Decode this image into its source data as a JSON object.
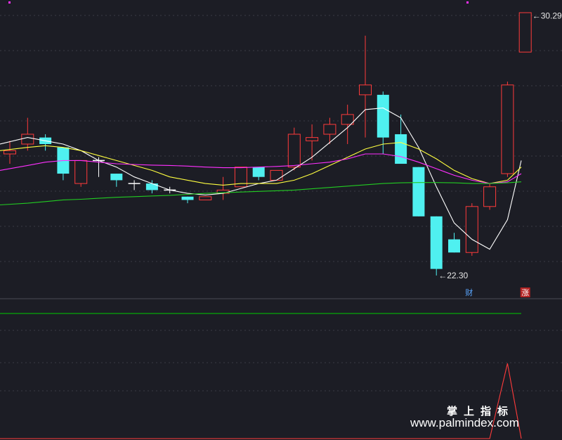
{
  "chart_data": {
    "type": "candlestick",
    "title": "",
    "colors": {
      "up": "#ff3b3b",
      "down": "#4ff0f0",
      "flat": "#ffffff",
      "ma5": "#ffffff",
      "ma10": "#ffff40",
      "ma20": "#ff30ff",
      "ma60": "#22cc22",
      "grid": "#3a3b45",
      "indicator_line": "#00cc00",
      "indicator_signal": "#ff3b3b",
      "marker": "#ff30ff"
    },
    "price_range": [
      21.7,
      30.6
    ],
    "candles": [
      {
        "o": 26.0,
        "h": 26.4,
        "l": 25.7,
        "c": 26.1
      },
      {
        "o": 26.3,
        "h": 27.1,
        "l": 26.1,
        "c": 26.6
      },
      {
        "o": 26.5,
        "h": 26.6,
        "l": 26.1,
        "c": 26.3
      },
      {
        "o": 26.2,
        "h": 26.2,
        "l": 25.2,
        "c": 25.4
      },
      {
        "o": 25.1,
        "h": 25.8,
        "l": 25.0,
        "c": 25.8
      },
      {
        "o": 25.8,
        "h": 25.9,
        "l": 25.3,
        "c": 25.8
      },
      {
        "o": 25.4,
        "h": 25.4,
        "l": 25.0,
        "c": 25.2
      },
      {
        "o": 25.1,
        "h": 25.2,
        "l": 24.9,
        "c": 25.1
      },
      {
        "o": 25.1,
        "h": 25.2,
        "l": 24.8,
        "c": 24.9
      },
      {
        "o": 24.9,
        "h": 25.0,
        "l": 24.8,
        "c": 24.9
      },
      {
        "o": 24.7,
        "h": 24.7,
        "l": 24.5,
        "c": 24.6
      },
      {
        "o": 24.6,
        "h": 24.7,
        "l": 24.6,
        "c": 24.7
      },
      {
        "o": 24.8,
        "h": 25.3,
        "l": 24.6,
        "c": 24.9
      },
      {
        "o": 25.0,
        "h": 25.6,
        "l": 25.0,
        "c": 25.6
      },
      {
        "o": 25.6,
        "h": 25.6,
        "l": 25.2,
        "c": 25.3
      },
      {
        "o": 25.2,
        "h": 25.5,
        "l": 25.2,
        "c": 25.5
      },
      {
        "o": 25.6,
        "h": 26.8,
        "l": 25.5,
        "c": 26.6
      },
      {
        "o": 26.4,
        "h": 26.9,
        "l": 25.8,
        "c": 26.5
      },
      {
        "o": 26.6,
        "h": 27.1,
        "l": 26.3,
        "c": 26.9
      },
      {
        "o": 26.9,
        "h": 27.5,
        "l": 26.3,
        "c": 27.2
      },
      {
        "o": 27.8,
        "h": 29.6,
        "l": 26.5,
        "c": 28.1
      },
      {
        "o": 27.8,
        "h": 27.9,
        "l": 26.0,
        "c": 26.5
      },
      {
        "o": 26.6,
        "h": 27.2,
        "l": 25.8,
        "c": 25.7
      },
      {
        "o": 25.6,
        "h": 25.6,
        "l": 24.1,
        "c": 24.1
      },
      {
        "o": 24.1,
        "h": 24.1,
        "l": 22.3,
        "c": 22.5
      },
      {
        "o": 23.4,
        "h": 23.6,
        "l": 23.0,
        "c": 23.0
      },
      {
        "o": 23.0,
        "h": 24.5,
        "l": 22.9,
        "c": 24.4
      },
      {
        "o": 24.4,
        "h": 25.1,
        "l": 24.3,
        "c": 25.0
      },
      {
        "o": 25.4,
        "h": 28.2,
        "l": 25.3,
        "c": 28.1
      },
      {
        "o": 29.1,
        "h": 30.3,
        "l": 29.1,
        "c": 30.3
      }
    ],
    "ma_series": [
      {
        "key": "ma5",
        "values": [
          26.3,
          26.5,
          26.4,
          26.3,
          26.1,
          25.8,
          25.6,
          25.3,
          25.1,
          24.9,
          24.8,
          24.75,
          24.8,
          24.95,
          25.1,
          25.2,
          25.55,
          25.9,
          26.35,
          26.8,
          27.35,
          27.4,
          27.1,
          26.2,
          25.0,
          23.9,
          23.4,
          23.1,
          24.0,
          25.8
        ]
      },
      {
        "key": "ma10",
        "values": [
          26.1,
          26.2,
          26.25,
          26.2,
          26.1,
          25.95,
          25.8,
          25.65,
          25.5,
          25.3,
          25.2,
          25.1,
          25.05,
          25.1,
          25.1,
          25.1,
          25.2,
          25.4,
          25.65,
          25.9,
          26.15,
          26.3,
          26.35,
          26.15,
          25.85,
          25.5,
          25.25,
          25.1,
          25.2,
          25.6
        ]
      },
      {
        "key": "ma20",
        "values": [
          25.5,
          25.65,
          25.75,
          25.8,
          25.8,
          25.75,
          25.7,
          25.68,
          25.66,
          25.65,
          25.63,
          25.6,
          25.58,
          25.58,
          25.6,
          25.62,
          25.65,
          25.7,
          25.75,
          25.85,
          26.0,
          26.0,
          25.92,
          25.75,
          25.55,
          25.35,
          25.2,
          25.1,
          25.15,
          25.4
        ]
      },
      {
        "key": "ma60",
        "values": [
          24.45,
          24.5,
          24.55,
          24.6,
          24.62,
          24.65,
          24.68,
          24.7,
          24.72,
          24.74,
          24.77,
          24.8,
          24.82,
          24.84,
          24.86,
          24.88,
          24.9,
          24.94,
          24.98,
          25.02,
          25.06,
          25.1,
          25.12,
          25.13,
          25.13,
          25.12,
          25.1,
          25.1,
          25.12,
          25.15
        ]
      }
    ],
    "annotations": [
      {
        "text": "30.29",
        "candle": 29,
        "value": 30.29,
        "arrow": "←"
      },
      {
        "text": "22.30",
        "candle": 24,
        "value": 22.3,
        "arrow": "←"
      }
    ],
    "badges": [
      {
        "text": "财",
        "candle": 26,
        "color": "#5aa6ff",
        "bg": ""
      },
      {
        "text": "涨",
        "candle": 29,
        "color": "#ffffff",
        "bg": "#b22222"
      }
    ],
    "indicator": {
      "line_value": 0.92,
      "signal": [
        0,
        0,
        0,
        0,
        0,
        0,
        0,
        0,
        0,
        0,
        0,
        0,
        0,
        0,
        0,
        0,
        0,
        0,
        0,
        0,
        0,
        0,
        0,
        0,
        0,
        0,
        0,
        0,
        1,
        0
      ]
    }
  },
  "watermark": {
    "line1": "掌上指标",
    "line2": "www.palmindex.com"
  }
}
